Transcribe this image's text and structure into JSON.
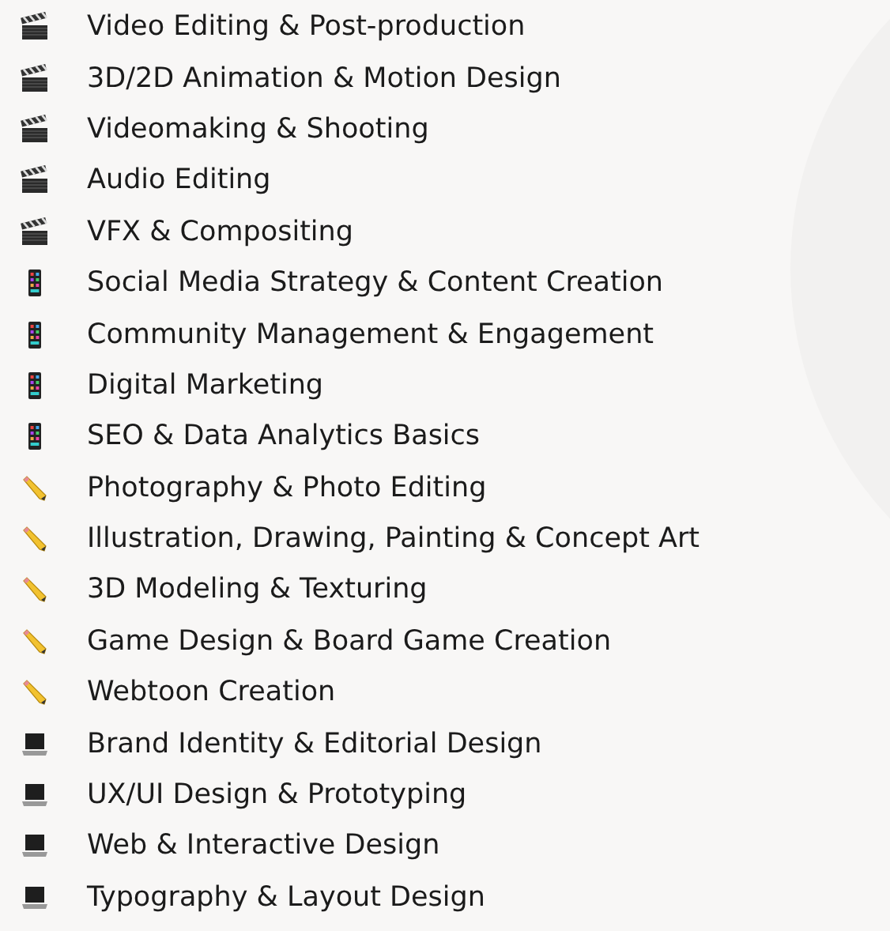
{
  "items": [
    {
      "kind": "clapper",
      "label": "Video Editing & Post-production"
    },
    {
      "kind": "clapper",
      "label": "3D/2D Animation & Motion Design"
    },
    {
      "kind": "clapper",
      "label": "Videomaking & Shooting"
    },
    {
      "kind": "clapper",
      "label": "Audio Editing"
    },
    {
      "kind": "clapper",
      "label": "VFX & Compositing"
    },
    {
      "kind": "phone",
      "label": "Social Media Strategy & Content Creation"
    },
    {
      "kind": "phone",
      "label": "Community Management & Engagement"
    },
    {
      "kind": "phone",
      "label": "Digital Marketing"
    },
    {
      "kind": "phone",
      "label": "SEO & Data Analytics Basics"
    },
    {
      "kind": "pencil",
      "label": "Photography & Photo Editing"
    },
    {
      "kind": "pencil",
      "label": "Illustration, Drawing, Painting & Concept Art"
    },
    {
      "kind": "pencil",
      "label": "3D Modeling & Texturing"
    },
    {
      "kind": "pencil",
      "label": "Game Design & Board Game Creation"
    },
    {
      "kind": "pencil",
      "label": "Webtoon Creation"
    },
    {
      "kind": "laptop",
      "label": "Brand Identity & Editorial Design"
    },
    {
      "kind": "laptop",
      "label": "UX/UI Design & Prototyping"
    },
    {
      "kind": "laptop",
      "label": "Web & Interactive Design"
    },
    {
      "kind": "laptop",
      "label": "Typography & Layout Design"
    }
  ]
}
